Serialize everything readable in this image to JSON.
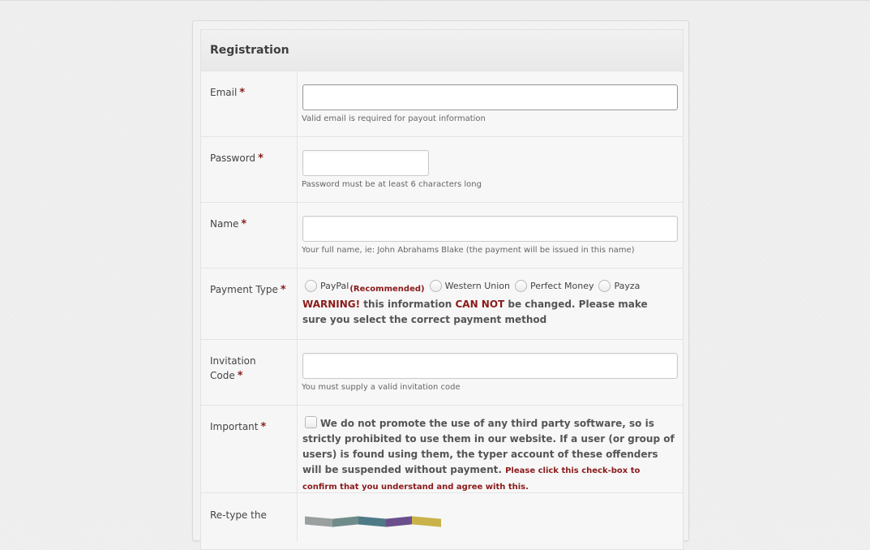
{
  "form": {
    "title": "Registration",
    "required_marker": "*",
    "email": {
      "label": "Email",
      "value": "",
      "help": "Valid email is required for payout information"
    },
    "password": {
      "label": "Password",
      "value": "",
      "help": "Password must be at least 6 characters long"
    },
    "name": {
      "label": "Name",
      "value": "",
      "help": "Your full name, ie: John Abrahams Blake (the payment will be issued in this name)"
    },
    "payment_type": {
      "label": "Payment Type",
      "options": [
        {
          "label": "PayPal",
          "note": "(Recommended)"
        },
        {
          "label": "Western Union"
        },
        {
          "label": "Perfect Money"
        },
        {
          "label": "Payza"
        }
      ],
      "warning_prefix": "WARNING!",
      "warning_part1": " this information ",
      "warning_emphasis": "CAN NOT",
      "warning_part2": " be changed. Please make sure you select the correct payment method"
    },
    "invitation_code": {
      "label_line1": "Invitation",
      "label_line2": "Code",
      "value": "",
      "help": "You must supply a valid invitation code"
    },
    "important": {
      "label": "Important",
      "text": "We do not promote the use of any third party software, so is strictly prohibited to use them in our website. If a user (or group of users) is found using them, the typer account of these offenders will be suspended without payment.",
      "confirm_note": "Please click this check-box to confirm that you understand and agree with this."
    },
    "captcha": {
      "label": "Re-type the",
      "colors": [
        "#9aa0a0",
        "#6f8c8a",
        "#4d7a86",
        "#6a4f8c",
        "#c9b24a"
      ]
    }
  }
}
